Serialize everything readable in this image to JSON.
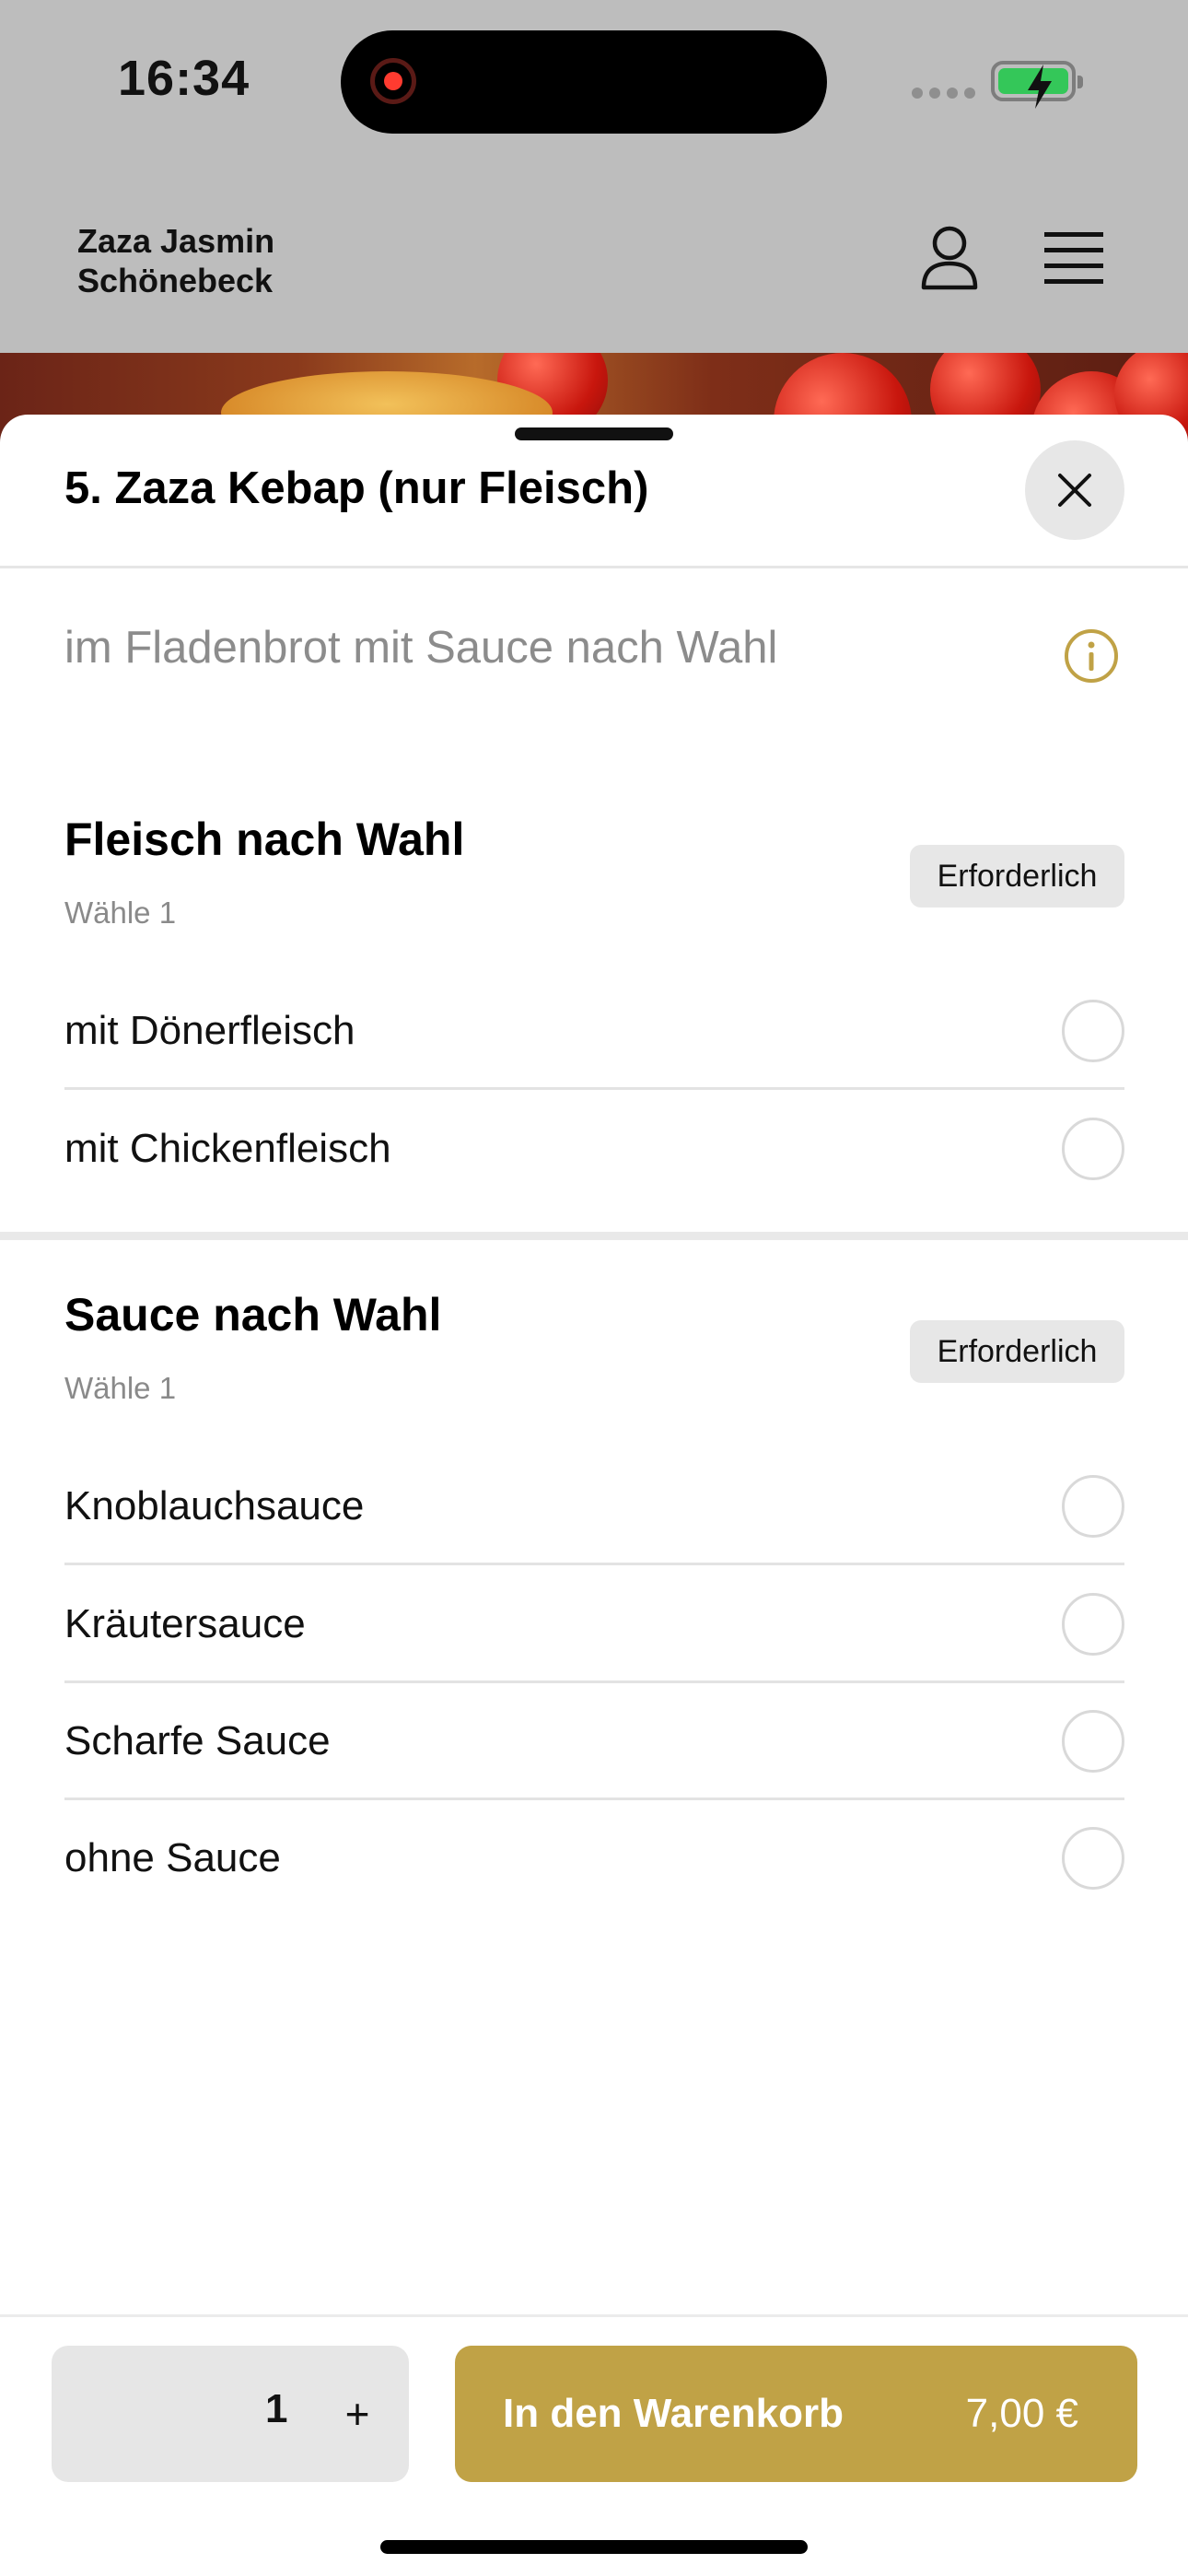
{
  "status_bar": {
    "time": "16:34"
  },
  "header": {
    "brand_line1": "Zaza Jasmin",
    "brand_line2": "Schönebeck"
  },
  "sheet": {
    "title": "5. Zaza Kebap (nur Fleisch)",
    "description": "im Fladenbrot mit Sauce nach Wahl",
    "groups": [
      {
        "title": "Fleisch nach Wahl",
        "subtitle": "Wähle 1",
        "badge": "Erforderlich",
        "options": [
          {
            "label": "mit Dönerfleisch",
            "selected": false
          },
          {
            "label": "mit Chickenfleisch",
            "selected": false
          }
        ]
      },
      {
        "title": "Sauce nach Wahl",
        "subtitle": "Wähle 1",
        "badge": "Erforderlich",
        "options": [
          {
            "label": "Knoblauchsauce",
            "selected": false
          },
          {
            "label": "Kräutersauce",
            "selected": false
          },
          {
            "label": "Scharfe Sauce",
            "selected": false
          },
          {
            "label": "ohne Sauce",
            "selected": false
          }
        ]
      }
    ]
  },
  "footer": {
    "quantity": "1",
    "plus_label": "+",
    "cart_label": "In den Warenkorb",
    "price": "7,00 €"
  },
  "colors": {
    "accent": "#c0a246",
    "info_icon": "#c0a246",
    "battery": "#34c759"
  },
  "icons": {
    "user": "user-icon",
    "menu": "menu-icon",
    "close": "close-icon",
    "info": "info-icon"
  }
}
